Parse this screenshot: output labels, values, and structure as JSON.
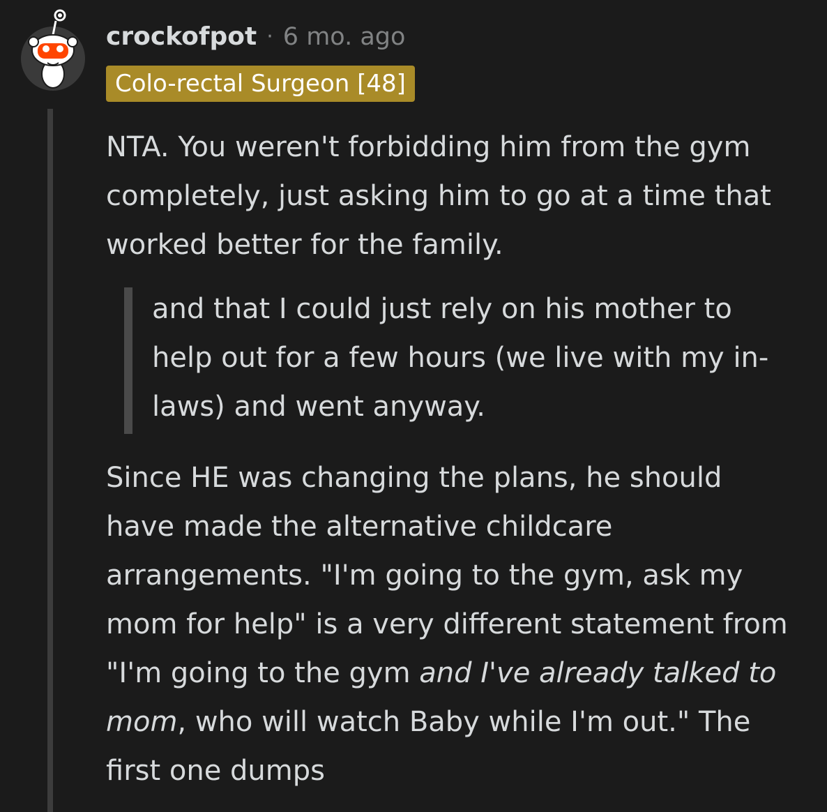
{
  "comment": {
    "author": "crockofpot",
    "separator": "·",
    "time": "6 mo. ago",
    "flair": "Colo-rectal Surgeon [48]",
    "paragraph1": "NTA. You weren't forbidding him from the gym completely, just asking him to go at a time that worked better for the family.",
    "quote": "and that I could just rely on his mother to help out for a few hours (we live with my in-laws) and went anyway.",
    "paragraph2": {
      "part1": "Since HE was changing the plans, he should have made the alternative childcare arrangements. \"I'm going to the gym, ask my mom for help\" is a very different statement from \"I'm going to the gym ",
      "emphasis": "and I've already talked to mom",
      "part2": ", who will watch Baby while I'm out.\" The first one dumps"
    }
  },
  "colors": {
    "background": "#1b1b1b",
    "text": "#d7dadc",
    "meta": "#818384",
    "flair_bg": "#a98b28",
    "thread_line": "#3c3c3c",
    "avatar_accent": "#ff4500"
  },
  "icons": {
    "avatar": "snoo-avatar-icon"
  }
}
